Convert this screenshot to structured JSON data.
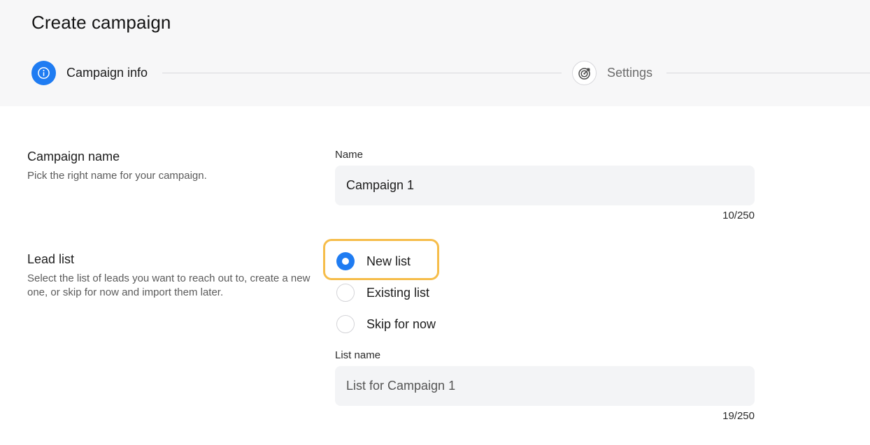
{
  "page": {
    "title": "Create campaign"
  },
  "steps": [
    {
      "label": "Campaign info",
      "icon": "info-icon",
      "state": "active"
    },
    {
      "label": "Settings",
      "icon": "target-icon",
      "state": "inactive"
    }
  ],
  "campaign_name": {
    "title": "Campaign name",
    "description": "Pick the right name for your campaign.",
    "field_label": "Name",
    "value": "Campaign 1",
    "counter": "10/250"
  },
  "lead_list": {
    "title": "Lead list",
    "description": "Select the list of leads you want to reach out to, create a new one, or skip for now and import them later.",
    "options": [
      {
        "label": "New list",
        "checked": true
      },
      {
        "label": "Existing list",
        "checked": false
      },
      {
        "label": "Skip for now",
        "checked": false
      }
    ],
    "list_name_label": "List name",
    "list_name_value": "List for Campaign 1",
    "list_name_counter": "19/250"
  },
  "colors": {
    "accent": "#1f7cf2",
    "highlight": "#f6bd4a",
    "header_bg": "#f7f7f8",
    "input_bg": "#f3f4f6"
  }
}
